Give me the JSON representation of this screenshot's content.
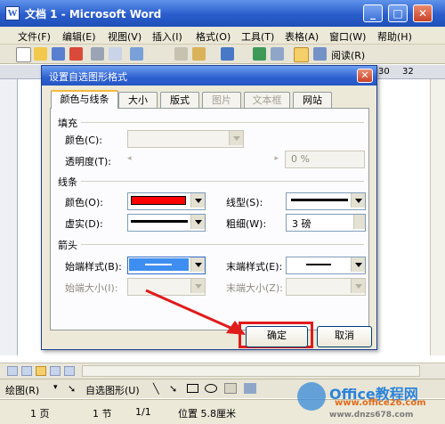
{
  "window": {
    "title": "文档 1 - Microsoft Word",
    "icon": "word-icon"
  },
  "menu": [
    "文件(F)",
    "编辑(E)",
    "视图(V)",
    "插入(I)",
    "格式(O)",
    "工具(T)",
    "表格(A)",
    "窗口(W)",
    "帮助(H)"
  ],
  "toolbar": {
    "read_label": "阅读(R)"
  },
  "ruler": {
    "n30": "30",
    "n32": "32"
  },
  "dialog": {
    "title": "设置自选图形格式",
    "tabs": [
      "颜色与线条",
      "大小",
      "版式",
      "图片",
      "文本框",
      "网站"
    ],
    "fill": {
      "section": "填充",
      "color_label": "颜色(C):",
      "transparency_label": "透明度(T):",
      "transparency_value": "0 %"
    },
    "line": {
      "section": "线条",
      "color_label": "颜色(O):",
      "style_label": "线型(S):",
      "dash_label": "虚实(D):",
      "weight_label": "粗细(W):",
      "weight_value": "3 磅",
      "color_value": "#ff0000"
    },
    "arrows": {
      "section": "箭头",
      "begin_style_label": "始端样式(B):",
      "end_style_label": "末端样式(E):",
      "begin_size_label": "始端大小(I):",
      "end_size_label": "末端大小(Z):"
    },
    "ok_label": "确定",
    "cancel_label": "取消"
  },
  "drawbar": {
    "draw_label": "绘图(R)",
    "autoshapes_label": "自选图形(U)"
  },
  "status": {
    "page": "1 页",
    "section": "1 节",
    "pages": "1/1",
    "position": "位置 5.8厘米"
  },
  "watermark": {
    "brand": "Office教程网",
    "url": "www.office26.com",
    "url2": "www.dnzs678.com"
  },
  "colors": {
    "accent": "#2a5dcc",
    "highlight": "#e01b1b",
    "red_swatch": "#ff0000"
  }
}
